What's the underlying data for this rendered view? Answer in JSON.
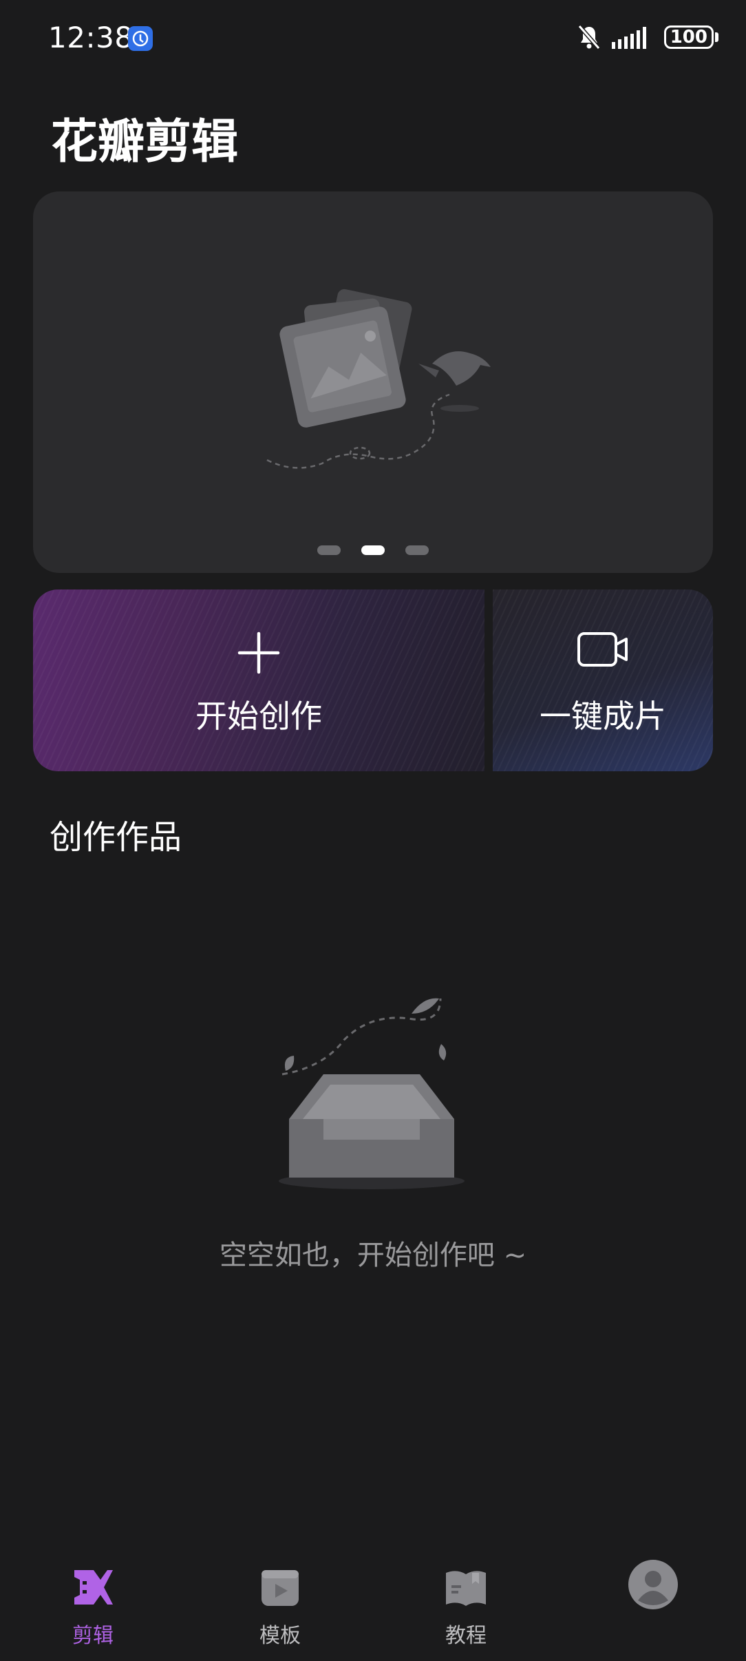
{
  "status_bar": {
    "time": "12:38",
    "battery": "100"
  },
  "app": {
    "title": "花瓣剪辑"
  },
  "banner": {
    "slides": 3,
    "active_slide": 2
  },
  "actions": {
    "start_create": {
      "label": "开始创作",
      "icon": "plus-icon"
    },
    "one_click": {
      "label": "一键成片",
      "icon": "video-camera-icon"
    }
  },
  "works": {
    "title": "创作作品",
    "empty_text": "空空如也，开始创作吧 ~"
  },
  "bottom_nav": {
    "items": [
      {
        "label": "剪辑",
        "icon": "edit-logo-icon",
        "active": true
      },
      {
        "label": "模板",
        "icon": "template-icon",
        "active": false
      },
      {
        "label": "教程",
        "icon": "tutorial-book-icon",
        "active": false
      },
      {
        "label": "",
        "icon": "profile-avatar-icon",
        "active": false
      }
    ]
  },
  "colors": {
    "background": "#1b1b1c",
    "accent": "#b063e6",
    "banner_bg": "#2b2b2d"
  }
}
